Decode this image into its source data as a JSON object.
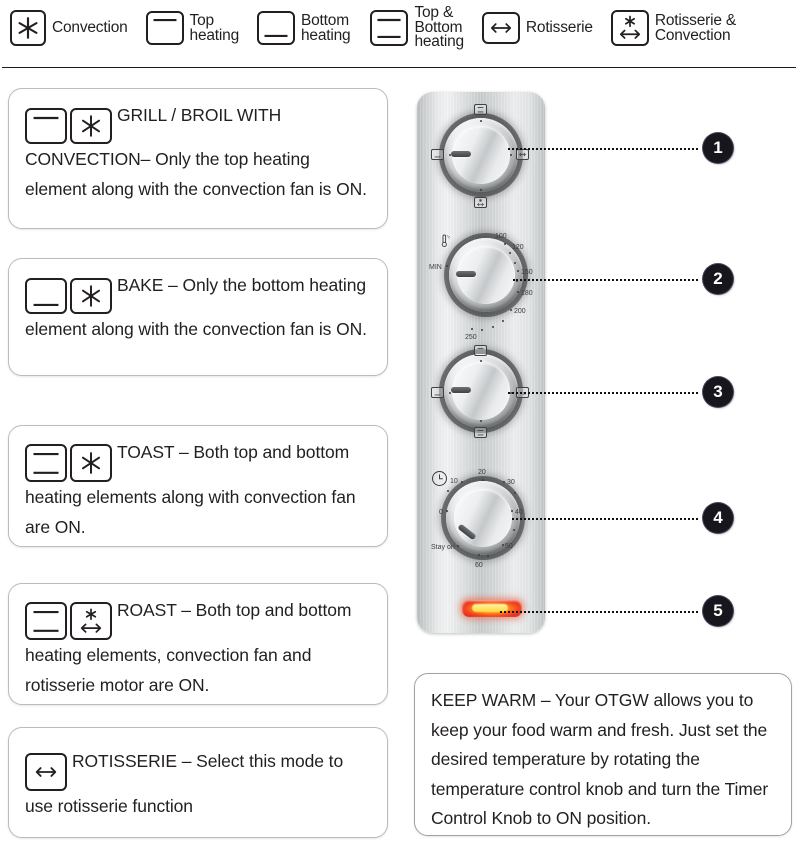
{
  "legend": {
    "items": [
      {
        "label": "Convection",
        "icon": "convection-icon",
        "lines": 1
      },
      {
        "label": "Top\nheating",
        "icon": "top-heating-icon",
        "lines": 2
      },
      {
        "label": "Bottom\nheating",
        "icon": "bottom-heating-icon",
        "lines": 2
      },
      {
        "label": "Top &\nBottom\nheating",
        "icon": "top-bottom-heating-icon",
        "lines": 3
      },
      {
        "label": "Rotisserie",
        "icon": "rotisserie-icon",
        "lines": 1
      },
      {
        "label": "Rotisserie &\nConvection",
        "icon": "rotisserie-convection-icon",
        "lines": 2
      }
    ]
  },
  "modes": [
    {
      "name": "grill-broil-with-convection",
      "icons": [
        "top-heating-icon",
        "convection-icon"
      ],
      "text": "GRILL / BROIL WITH CONVECTION– Only the top heating element along with the convection fan is ON."
    },
    {
      "name": "bake",
      "icons": [
        "bottom-heating-icon",
        "convection-icon"
      ],
      "text": "BAKE – Only the bottom heating element along with the convection fan is ON."
    },
    {
      "name": "toast",
      "icons": [
        "top-bottom-heating-icon",
        "convection-icon"
      ],
      "text": "TOAST – Both top and bottom  heating elements along with convection fan are ON."
    },
    {
      "name": "roast",
      "icons": [
        "top-bottom-heating-icon",
        "rotisserie-convection-icon"
      ],
      "text": "ROAST – Both top and bottom heating elements, convection fan and rotisserie motor are ON."
    },
    {
      "name": "rotisserie",
      "icons": [
        "rotisserie-icon"
      ],
      "text": "ROTISSERIE – Select this mode to use rotisserie function"
    }
  ],
  "panel": {
    "knob1": {
      "name": "function-selector-knob-upper",
      "marks": [
        "top-bottom-heating-icon",
        "bottom-heating-icon",
        "rotisserie-icon",
        "rotisserie-convection-icon"
      ]
    },
    "knob2": {
      "name": "temperature-control-knob",
      "unit_icon": "thermometer-icon",
      "unit": "°c",
      "min_label": "MIN",
      "ticks": [
        "100",
        "120",
        "150",
        "180",
        "200",
        "250"
      ]
    },
    "knob3": {
      "name": "function-selector-knob-lower",
      "marks": [
        "top-heating-icon",
        "bottom-heating-icon",
        "top-bottom-heating-icon",
        "convection-icon"
      ]
    },
    "knob4": {
      "name": "timer-control-knob",
      "clock_icon": "clock-icon",
      "stay_on_label": "Stay on",
      "ticks": [
        "0",
        "10",
        "20",
        "30",
        "40",
        "50",
        "60"
      ]
    },
    "indicator": {
      "name": "power-indicator-lamp",
      "color": "#f2431f"
    }
  },
  "callouts": [
    {
      "number": "1",
      "target": "function-selector-knob-upper"
    },
    {
      "number": "2",
      "target": "temperature-control-knob"
    },
    {
      "number": "3",
      "target": "function-selector-knob-lower"
    },
    {
      "number": "4",
      "target": "timer-control-knob"
    },
    {
      "number": "5",
      "target": "power-indicator-lamp"
    }
  ],
  "keep_warm": {
    "text": " KEEP WARM – Your OTGW allows you to keep your food warm and fresh. Just set the desired temperature by rotating the temperature control knob and turn the Timer Control Knob to ON position."
  },
  "colors": {
    "ink": "#231f20",
    "card_border": "#b9bcc0",
    "badge": "#17161c",
    "lamp": "#f2431f"
  }
}
